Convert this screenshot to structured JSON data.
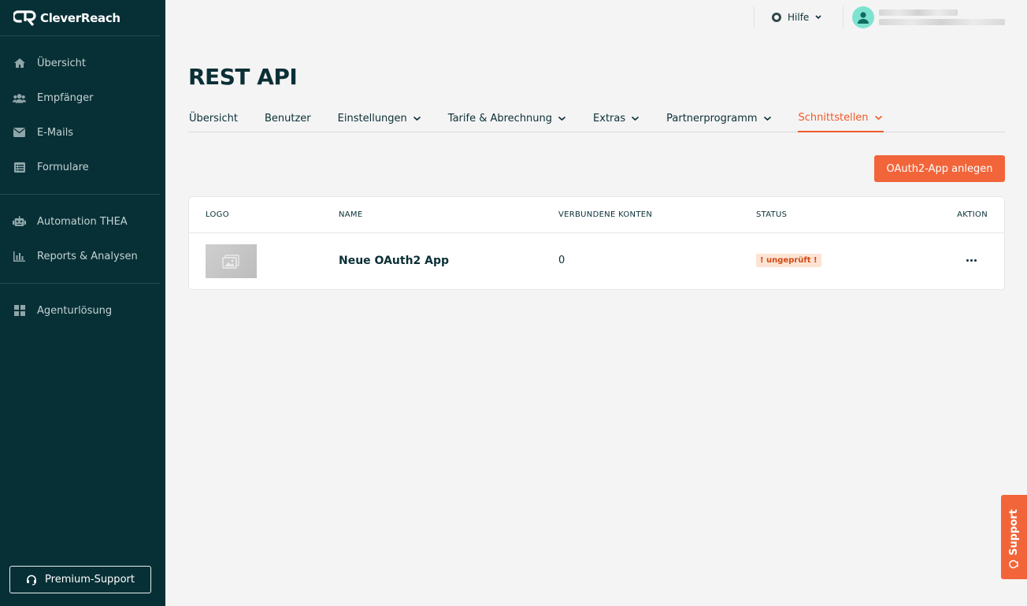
{
  "brand": {
    "name": "CleverReach"
  },
  "sidebar": {
    "groups": [
      [
        {
          "label": "Übersicht",
          "icon": "home-icon"
        },
        {
          "label": "Empfänger",
          "icon": "users-icon"
        },
        {
          "label": "E-Mails",
          "icon": "envelope-icon"
        },
        {
          "label": "Formulare",
          "icon": "form-list-icon"
        }
      ],
      [
        {
          "label": "Automation THEA",
          "icon": "robot-icon"
        },
        {
          "label": "Reports & Analysen",
          "icon": "bar-chart-icon"
        }
      ],
      [
        {
          "label": "Agenturlösung",
          "icon": "grid-icon"
        }
      ]
    ],
    "premium_support": "Premium-Support"
  },
  "topbar": {
    "help_label": "Hilfe"
  },
  "page": {
    "title": "REST API",
    "tabs": [
      {
        "label": "Übersicht",
        "dropdown": false,
        "active": false
      },
      {
        "label": "Benutzer",
        "dropdown": false,
        "active": false
      },
      {
        "label": "Einstellungen",
        "dropdown": true,
        "active": false
      },
      {
        "label": "Tarife & Abrechnung",
        "dropdown": true,
        "active": false
      },
      {
        "label": "Extras",
        "dropdown": true,
        "active": false
      },
      {
        "label": "Partnerprogramm",
        "dropdown": true,
        "active": false
      },
      {
        "label": "Schnittstellen",
        "dropdown": true,
        "active": true
      }
    ],
    "create_button": "OAuth2-App anlegen"
  },
  "table": {
    "columns": {
      "logo": "LOGO",
      "name": "NAME",
      "accounts": "VERBUNDENE KONTEN",
      "status": "STATUS",
      "action": "AKTION"
    },
    "rows": [
      {
        "name": "Neue OAuth2 App",
        "accounts": "0",
        "status": "! ungeprüft !"
      }
    ]
  },
  "support_tab": {
    "label": "Support"
  },
  "colors": {
    "sidebar_bg": "#073036",
    "accent": "#f2653a",
    "page_bg": "#f4f4f4",
    "avatar": "#7ee2d0"
  }
}
